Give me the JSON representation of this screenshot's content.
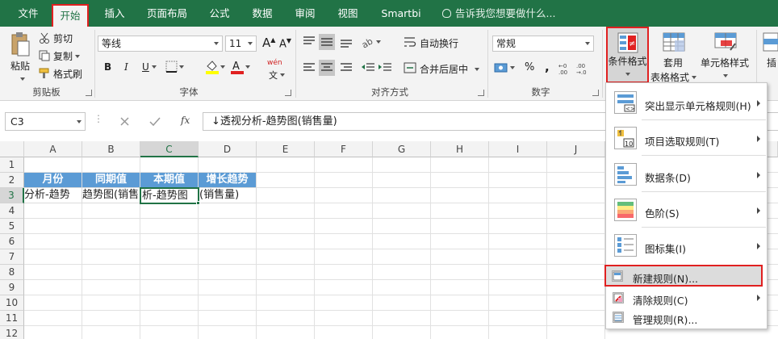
{
  "tabs": [
    "文件",
    "开始",
    "插入",
    "页面布局",
    "公式",
    "数据",
    "审阅",
    "视图",
    "Smartbi"
  ],
  "tell_me": "告诉我您想要做什么...",
  "clipboard": {
    "paste": "粘贴",
    "cut": "剪切",
    "copy": "复制",
    "format_painter": "格式刷",
    "group": "剪贴板"
  },
  "font": {
    "name": "等线",
    "size": "11",
    "grow": "A",
    "shrink": "A",
    "bold": "B",
    "italic": "I",
    "underline": "U",
    "font_color": "A",
    "phonetic": "wén",
    "group": "字体"
  },
  "alignment": {
    "wrap": "自动换行",
    "merge": "合并后居中",
    "group": "对齐方式"
  },
  "number": {
    "format": "常规",
    "percent": "%",
    "comma": ",",
    "group": "数字"
  },
  "styles": {
    "conditional": "条件格式",
    "table_line1": "套用",
    "table_line2": "表格格式",
    "cell_styles": "单元格样式",
    "insert": "插"
  },
  "formula_bar": {
    "name_box": "C3",
    "fx": "fx",
    "formula": "↓透视分析-趋势图(销售量)"
  },
  "columns": [
    "A",
    "B",
    "C",
    "D",
    "E",
    "F",
    "G",
    "H",
    "I",
    "J"
  ],
  "rows": [
    "1",
    "2",
    "3",
    "4",
    "5",
    "6",
    "7",
    "8",
    "9",
    "10",
    "11",
    "12"
  ],
  "cells": {
    "a2": "月份",
    "b2": "同期值",
    "c2": "本期值",
    "d2": "增长趋势",
    "a3": "分析-趋势",
    "b3": "趋势图(销售",
    "c3": "析-趋势图",
    "d3": "(销售量)"
  },
  "menu": {
    "highlight": "突出显示单元格规则(H)",
    "topbottom": "项目选取规则(T)",
    "databars": "数据条(D)",
    "colorscales": "色阶(S)",
    "iconsets": "图标集(I)",
    "new_rule": "新建规则(N)...",
    "clear_rules": "清除规则(C)",
    "manage_rules": "管理规则(R)..."
  },
  "colors": {
    "excel_green": "#217346",
    "header_blue": "#5b9bd5",
    "highlight_red": "#e02020"
  }
}
